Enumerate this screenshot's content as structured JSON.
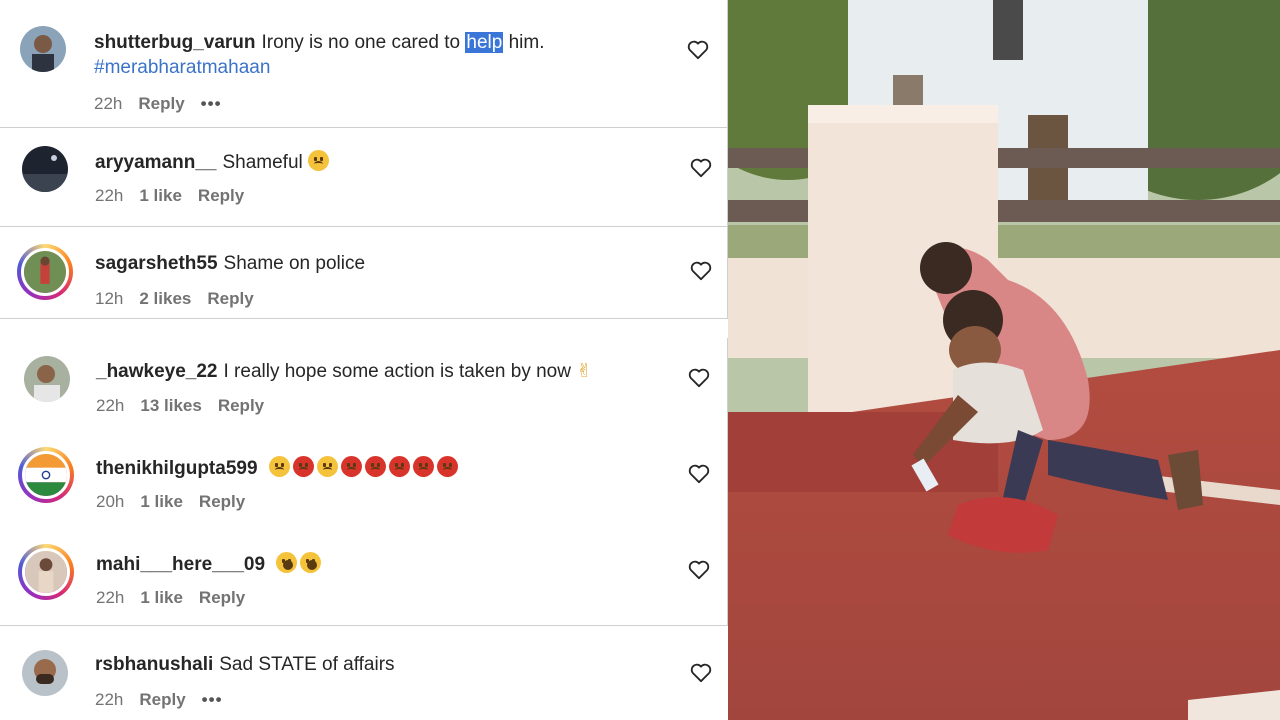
{
  "comments": [
    {
      "user": "shutterbug_varun",
      "text_before": "Irony is no one cared to ",
      "highlight": "help",
      "text_after": " him.",
      "hashtag": "#merabharatmahaan",
      "time": "22h",
      "likes": "",
      "reply": "Reply",
      "more": "•••"
    },
    {
      "user": "aryyamann__",
      "text": "Shameful",
      "time": "22h",
      "likes": "1 like",
      "reply": "Reply"
    },
    {
      "user": "sagarsheth55",
      "text": "Shame on police",
      "time": "12h",
      "likes": "2 likes",
      "reply": "Reply"
    },
    {
      "user": "_hawkeye_22",
      "text": "I really hope some action is taken by now",
      "time": "22h",
      "likes": "13 likes",
      "reply": "Reply"
    },
    {
      "user": "thenikhilgupta599",
      "text": "",
      "time": "20h",
      "likes": "1 like",
      "reply": "Reply"
    },
    {
      "user": "mahi___here___09",
      "text": "",
      "time": "22h",
      "likes": "1 like",
      "reply": "Reply"
    },
    {
      "user": "rsbhanushali",
      "text": "Sad STATE of affairs",
      "time": "22h",
      "likes": "",
      "reply": "Reply",
      "more": "•••"
    }
  ],
  "colors": {
    "hashtag": "#3b73c8",
    "highlight": "#3a76d8",
    "meta": "#737373"
  },
  "icons": {
    "like": "heart-outline-icon",
    "more": "more-dots-icon"
  }
}
